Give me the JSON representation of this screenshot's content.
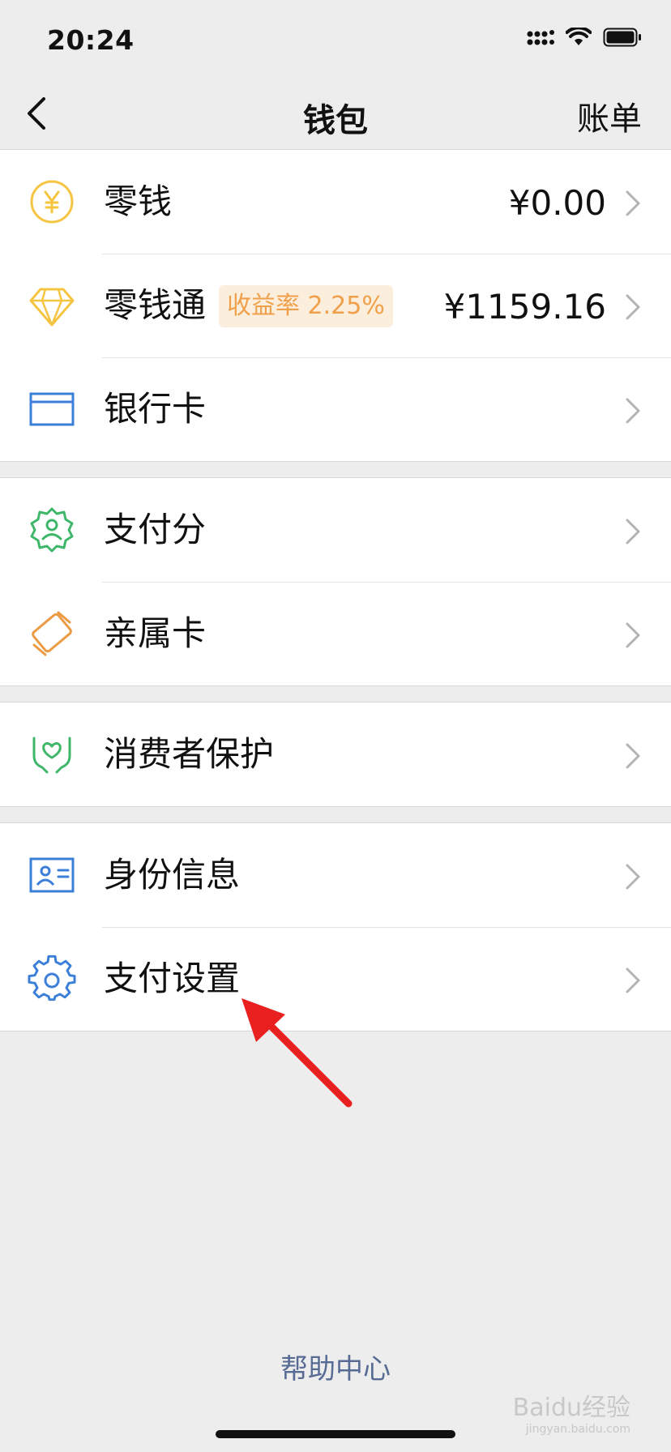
{
  "status_bar": {
    "time": "20:24"
  },
  "nav": {
    "title": "钱包",
    "right_label": "账单"
  },
  "groups": [
    {
      "items": [
        {
          "label": "零钱",
          "value": "¥0.00",
          "icon": "yuan-coin-icon"
        },
        {
          "label": "零钱通",
          "badge": "收益率 2.25%",
          "value": "¥1159.16",
          "icon": "diamond-icon"
        },
        {
          "label": "银行卡",
          "icon": "bank-card-icon"
        }
      ]
    },
    {
      "items": [
        {
          "label": "支付分",
          "icon": "pay-score-icon"
        },
        {
          "label": "亲属卡",
          "icon": "family-card-icon"
        }
      ]
    },
    {
      "items": [
        {
          "label": "消费者保护",
          "icon": "protection-hands-icon"
        }
      ]
    },
    {
      "items": [
        {
          "label": "身份信息",
          "icon": "id-card-icon"
        },
        {
          "label": "支付设置",
          "icon": "gear-icon"
        }
      ]
    }
  ],
  "footer": {
    "help_link": "帮助中心"
  },
  "watermark": {
    "text": "Baidu经验",
    "sub": "jingyan.baidu.com"
  },
  "colors": {
    "yellow": "#f5c542",
    "blue": "#3c7fd8",
    "green": "#3fb76a",
    "orange": "#ec9b45",
    "link": "#576b95",
    "badge_bg": "#fbeedc",
    "badge_text": "#f0a04b",
    "annotation_arrow": "#e8201f"
  }
}
